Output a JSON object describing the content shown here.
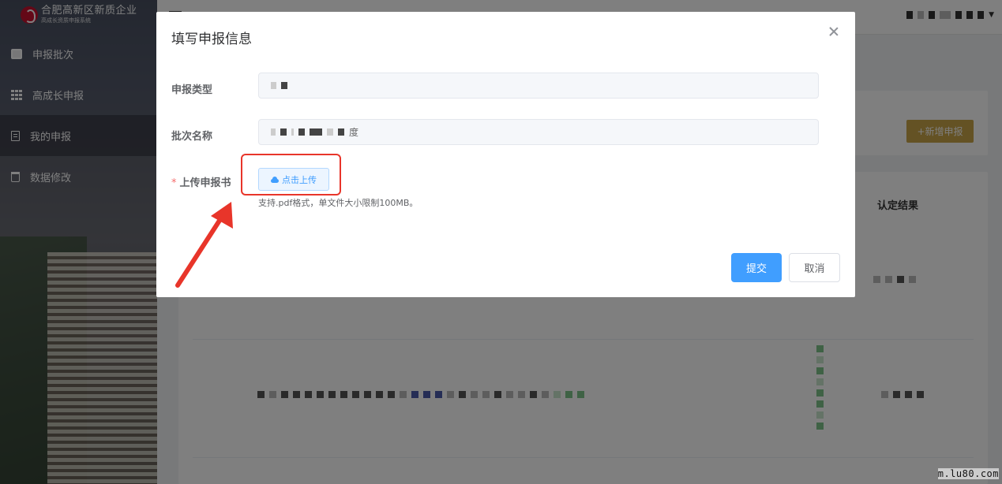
{
  "brand": {
    "title": "合肥高新区新质企业",
    "subtitle": "高成长资质申报系统"
  },
  "sidebar": {
    "items": [
      {
        "label": "申报批次",
        "icon": "briefcase-icon",
        "active": false
      },
      {
        "label": "高成长申报",
        "icon": "grid-icon",
        "active": false
      },
      {
        "label": "我的申报",
        "icon": "document-icon",
        "active": true
      },
      {
        "label": "数据修改",
        "icon": "trash-icon",
        "active": false
      }
    ]
  },
  "background": {
    "add_button": "+新增申报",
    "table_header_result": "认定结果"
  },
  "dialog": {
    "title": "填写申报信息",
    "fields": {
      "type_label": "申报类型",
      "batch_label": "批次名称",
      "upload_label": "上传申报书",
      "batch_suffix": "度"
    },
    "upload_button": "点击上传",
    "upload_hint": "支持.pdf格式，单文件大小限制100MB。",
    "submit": "提交",
    "cancel": "取消"
  },
  "colors": {
    "primary": "#409eff",
    "gold": "#c9a548",
    "highlight": "#e8352a",
    "required": "#f56c6c"
  },
  "watermark": "m.lu80.com"
}
